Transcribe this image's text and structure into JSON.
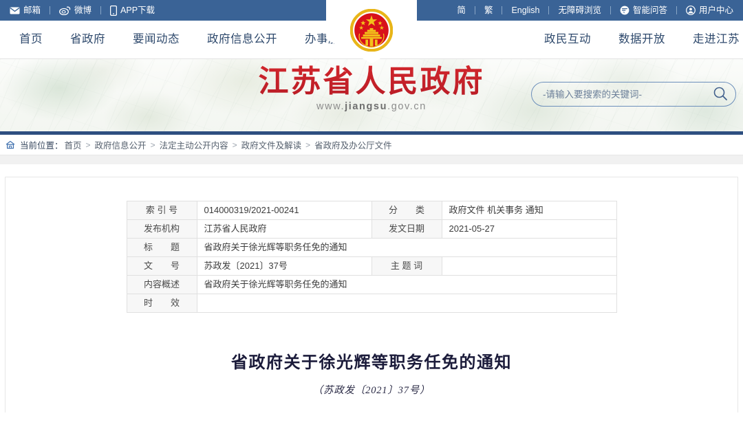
{
  "topbar": {
    "left_items": [
      {
        "icon": "mail-icon",
        "label": "邮箱"
      },
      {
        "icon": "weibo-icon",
        "label": "微博"
      },
      {
        "icon": "mobile-phone-icon",
        "label": "APP下载"
      }
    ],
    "right_items": [
      {
        "icon": "",
        "label": "简"
      },
      {
        "icon": "",
        "label": "繁"
      },
      {
        "icon": "",
        "label": "English"
      },
      {
        "icon": "",
        "label": "无障碍浏览"
      },
      {
        "icon": "chat-bubble-icon",
        "label": "智能问答"
      },
      {
        "icon": "user-circle-icon",
        "label": "用户中心"
      }
    ],
    "background_color": "#3a6396"
  },
  "nav": {
    "left_items": [
      "首页",
      "省政府",
      "要闻动态",
      "政府信息公开",
      "办事服务"
    ],
    "right_items": [
      "政民互动",
      "数据开放",
      "走进江苏"
    ],
    "text_color": "#2f4a6d"
  },
  "banner": {
    "emblem": "national-emblem",
    "title_cn": "江苏省人民政府",
    "url_prefix": "www.",
    "url_brand": "jiangsu",
    "url_suffix": ".gov.cn",
    "title_color": "#c6202a",
    "search": {
      "placeholder": "-请输入要搜索的关键词-",
      "value": "",
      "icon": "search-icon"
    }
  },
  "breadcrumb": {
    "home_icon": "home-icon",
    "label": "当前位置：",
    "separator": ">",
    "items": [
      "首页",
      "政府信息公开",
      "法定主动公开内容",
      "政府文件及解读",
      "省政府及办公厅文件"
    ]
  },
  "info_table": {
    "rows": [
      {
        "cells": [
          {
            "type": "label",
            "text": "索 引 号",
            "colspan": 1
          },
          {
            "type": "value",
            "text": "014000319/2021-00241",
            "colspan": 1
          },
          {
            "type": "label",
            "text": "分　　类",
            "colspan": 1
          },
          {
            "type": "value",
            "text": "政府文件 机关事务 通知",
            "colspan": 1
          }
        ]
      },
      {
        "cells": [
          {
            "type": "label",
            "text": "发布机构",
            "colspan": 1
          },
          {
            "type": "value",
            "text": "江苏省人民政府",
            "colspan": 1
          },
          {
            "type": "label",
            "text": "发文日期",
            "colspan": 1
          },
          {
            "type": "value",
            "text": "2021-05-27",
            "colspan": 1
          }
        ]
      },
      {
        "cells": [
          {
            "type": "label",
            "text": "标　　题",
            "colspan": 1
          },
          {
            "type": "value",
            "text": "省政府关于徐光辉等职务任免的通知",
            "colspan": 3
          }
        ]
      },
      {
        "cells": [
          {
            "type": "label",
            "text": "文　　号",
            "colspan": 1
          },
          {
            "type": "value",
            "text": "苏政发〔2021〕37号",
            "colspan": 1
          },
          {
            "type": "label",
            "text": "主 题 词",
            "colspan": 1
          },
          {
            "type": "value",
            "text": "",
            "colspan": 1
          }
        ]
      },
      {
        "cells": [
          {
            "type": "label",
            "text": "内容概述",
            "colspan": 1
          },
          {
            "type": "value",
            "text": "省政府关于徐光辉等职务任免的通知",
            "colspan": 3
          }
        ]
      },
      {
        "cells": [
          {
            "type": "label",
            "text": "时　　效",
            "colspan": 1
          },
          {
            "type": "value",
            "text": "",
            "colspan": 3
          }
        ]
      }
    ]
  },
  "document": {
    "title": "省政府关于徐光辉等职务任免的通知",
    "subtitle": "（苏政发〔2021〕37号）"
  }
}
